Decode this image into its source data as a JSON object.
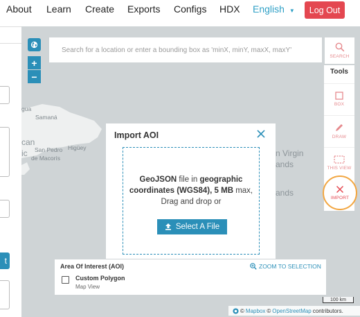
{
  "nav": {
    "items": [
      "About",
      "Learn",
      "Create",
      "Exports",
      "Configs",
      "HDX"
    ],
    "language": "English",
    "logout": "Log Out"
  },
  "left_panel": {
    "button_fragment": "t"
  },
  "map": {
    "labels": [
      "gua",
      "Samaná",
      "can",
      "San Pedro",
      "Higüey",
      "ic",
      "de Macorís",
      "n Virgin",
      "ands",
      "ands"
    ],
    "search_placeholder": "Search for a location or enter a bounding box as 'minX, minY, maxX, maxY'",
    "search_label": "SEARCH",
    "zoom_in": "+",
    "zoom_out": "−",
    "scale": "100 km",
    "attribution": {
      "mapbox": "Mapbox",
      "osm": "OpenStreetMap",
      "suffix": "contributors."
    }
  },
  "tools": {
    "title": "Tools",
    "items": [
      "BOX",
      "DRAW",
      "THIS VIEW",
      "IMPORT"
    ]
  },
  "modal": {
    "title": "Import AOI",
    "line1_a": "GeoJSON",
    "line1_b": " file in ",
    "line1_c": "geographic",
    "line2_a": "coordinates (WGS84), 5 MB",
    "line2_b": " max,",
    "line3": "Drag and drop or",
    "button": "Select A File"
  },
  "aoi": {
    "title": "Area Of Interest (AOI)",
    "zoom": "ZOOM TO SELECTION",
    "item_name": "Custom Polygon",
    "item_sub": "Map View"
  },
  "colors": {
    "accent": "#2b8fb8",
    "danger": "#e44750",
    "highlight": "#f2a640"
  }
}
